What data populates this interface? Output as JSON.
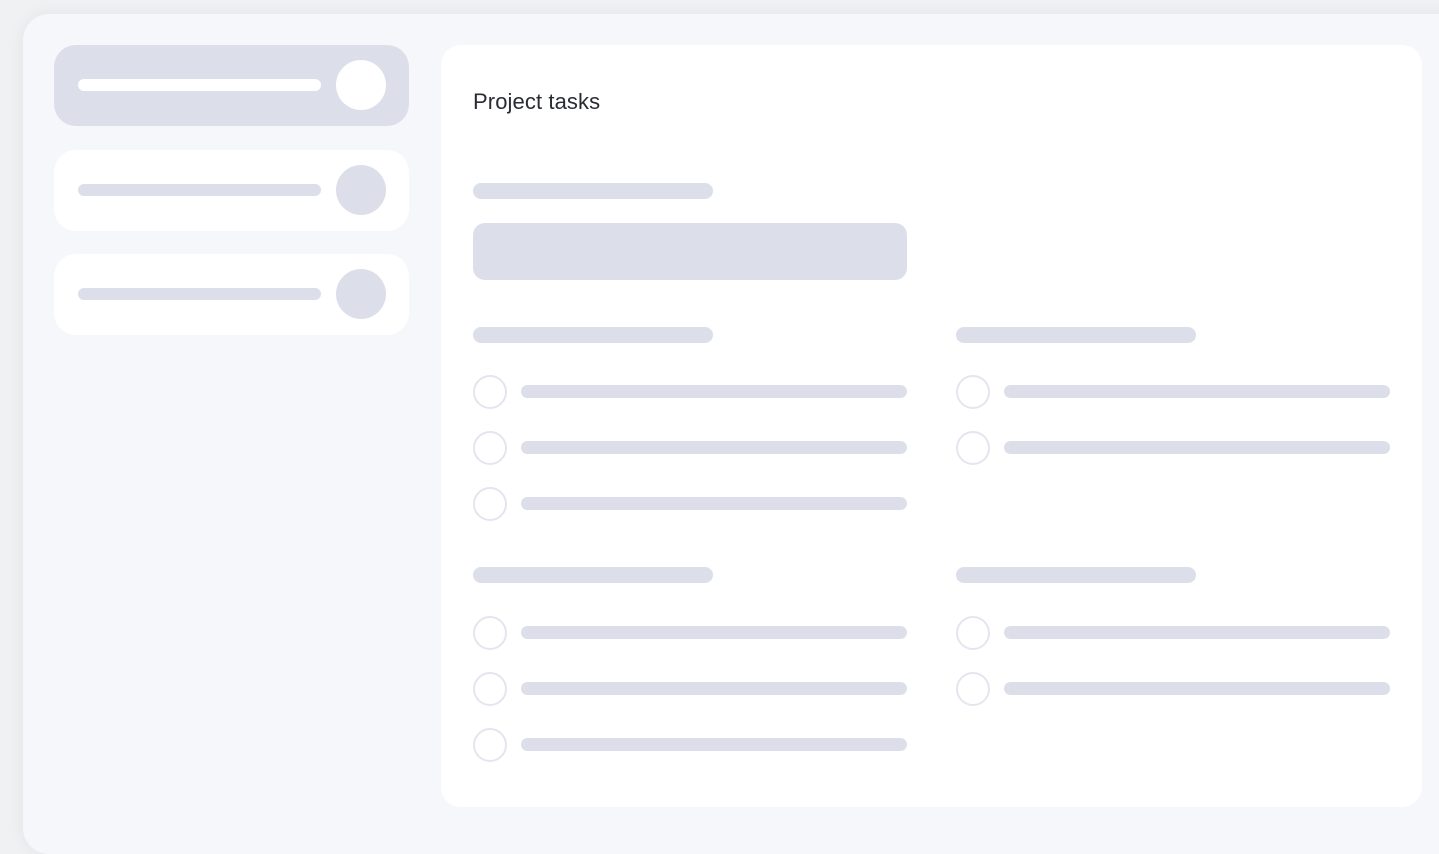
{
  "main": {
    "title": "Project tasks"
  },
  "sidebar": {
    "items": [
      {
        "state": "active"
      },
      {
        "state": "inactive"
      },
      {
        "state": "inactive"
      }
    ]
  },
  "colors": {
    "page_background": "#f6f7fb",
    "panel_background": "#ffffff",
    "skeleton": "#dcdfea",
    "checkbox_border": "#e4e6ef",
    "title_text": "#2a2c33"
  },
  "icons": {
    "task_checkbox": "empty-circle-checkbox-icon",
    "sidebar_avatar": "avatar-placeholder-icon"
  }
}
